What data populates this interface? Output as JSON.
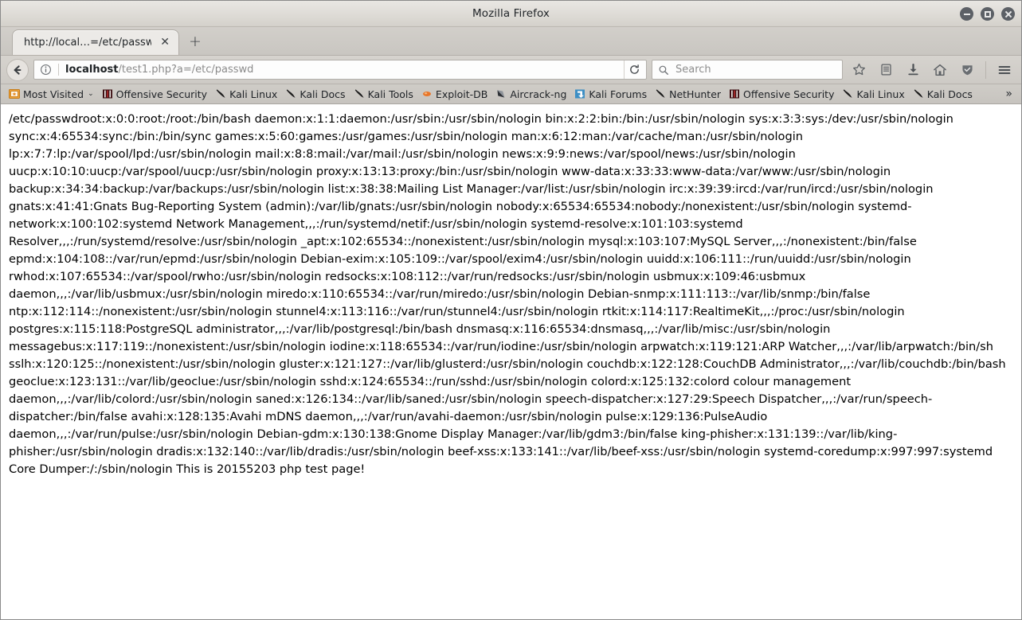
{
  "window": {
    "title": "Mozilla Firefox",
    "controls": [
      {
        "name": "minimize",
        "label": "–"
      },
      {
        "name": "maximize",
        "label": "□"
      },
      {
        "name": "close",
        "label": "✕"
      }
    ]
  },
  "tabs": {
    "items": [
      {
        "label": "http://local…=/etc/passwd",
        "close_label": "✕",
        "active": true
      }
    ],
    "new_tab_label": "+"
  },
  "toolbar": {
    "back_icon": "back-arrow-icon",
    "identity_icon": "info-circle-icon",
    "url_host": "localhost",
    "url_path": "/test1.php?a=/etc/passwd",
    "url_full": "localhost/test1.php?a=/etc/passwd",
    "reload_icon": "reload-icon",
    "search_placeholder": "Search",
    "search_value": "",
    "buttons": [
      {
        "name": "bookmark-star-button",
        "icon": "star-icon"
      },
      {
        "name": "library-button",
        "icon": "library-icon"
      },
      {
        "name": "downloads-button",
        "icon": "download-arrow-icon"
      },
      {
        "name": "home-button",
        "icon": "home-icon"
      },
      {
        "name": "tracking-protection-button",
        "icon": "shield-icon"
      },
      {
        "name": "menu-button",
        "icon": "hamburger-menu-icon"
      }
    ]
  },
  "bookmarks": {
    "items": [
      {
        "label": "Most Visited",
        "icon": "folder-star-icon",
        "caret": "⌄"
      },
      {
        "label": "Offensive Security",
        "icon": "offsec-icon"
      },
      {
        "label": "Kali Linux",
        "icon": "kali-dragon-icon"
      },
      {
        "label": "Kali Docs",
        "icon": "kali-dragon-icon"
      },
      {
        "label": "Kali Tools",
        "icon": "kali-dragon-icon"
      },
      {
        "label": "Exploit-DB",
        "icon": "exploitdb-icon"
      },
      {
        "label": "Aircrack-ng",
        "icon": "aircrack-icon"
      },
      {
        "label": "Kali Forums",
        "icon": "forums-icon"
      },
      {
        "label": "NetHunter",
        "icon": "kali-dragon-icon"
      },
      {
        "label": "Offensive Security",
        "icon": "offsec-icon"
      },
      {
        "label": "Kali Linux",
        "icon": "kali-dragon-icon"
      },
      {
        "label": "Kali Docs",
        "icon": "kali-dragon-icon"
      }
    ],
    "overflow_label": "»"
  },
  "page": {
    "body_text": "/etc/passwdroot:x:0:0:root:/root:/bin/bash daemon:x:1:1:daemon:/usr/sbin:/usr/sbin/nologin bin:x:2:2:bin:/bin:/usr/sbin/nologin sys:x:3:3:sys:/dev:/usr/sbin/nologin sync:x:4:65534:sync:/bin:/bin/sync games:x:5:60:games:/usr/games:/usr/sbin/nologin man:x:6:12:man:/var/cache/man:/usr/sbin/nologin lp:x:7:7:lp:/var/spool/lpd:/usr/sbin/nologin mail:x:8:8:mail:/var/mail:/usr/sbin/nologin news:x:9:9:news:/var/spool/news:/usr/sbin/nologin uucp:x:10:10:uucp:/var/spool/uucp:/usr/sbin/nologin proxy:x:13:13:proxy:/bin:/usr/sbin/nologin www-data:x:33:33:www-data:/var/www:/usr/sbin/nologin backup:x:34:34:backup:/var/backups:/usr/sbin/nologin list:x:38:38:Mailing List Manager:/var/list:/usr/sbin/nologin irc:x:39:39:ircd:/var/run/ircd:/usr/sbin/nologin gnats:x:41:41:Gnats Bug-Reporting System (admin):/var/lib/gnats:/usr/sbin/nologin nobody:x:65534:65534:nobody:/nonexistent:/usr/sbin/nologin systemd-network:x:100:102:systemd Network Management,,,:/run/systemd/netif:/usr/sbin/nologin systemd-resolve:x:101:103:systemd Resolver,,,:/run/systemd/resolve:/usr/sbin/nologin _apt:x:102:65534::/nonexistent:/usr/sbin/nologin mysql:x:103:107:MySQL Server,,,:/nonexistent:/bin/false epmd:x:104:108::/var/run/epmd:/usr/sbin/nologin Debian-exim:x:105:109::/var/spool/exim4:/usr/sbin/nologin uuidd:x:106:111::/run/uuidd:/usr/sbin/nologin rwhod:x:107:65534::/var/spool/rwho:/usr/sbin/nologin redsocks:x:108:112::/var/run/redsocks:/usr/sbin/nologin usbmux:x:109:46:usbmux daemon,,,:/var/lib/usbmux:/usr/sbin/nologin miredo:x:110:65534::/var/run/miredo:/usr/sbin/nologin Debian-snmp:x:111:113::/var/lib/snmp:/bin/false ntp:x:112:114::/nonexistent:/usr/sbin/nologin stunnel4:x:113:116::/var/run/stunnel4:/usr/sbin/nologin rtkit:x:114:117:RealtimeKit,,,:/proc:/usr/sbin/nologin postgres:x:115:118:PostgreSQL administrator,,,:/var/lib/postgresql:/bin/bash dnsmasq:x:116:65534:dnsmasq,,,:/var/lib/misc:/usr/sbin/nologin messagebus:x:117:119::/nonexistent:/usr/sbin/nologin iodine:x:118:65534::/var/run/iodine:/usr/sbin/nologin arpwatch:x:119:121:ARP Watcher,,,:/var/lib/arpwatch:/bin/sh sslh:x:120:125::/nonexistent:/usr/sbin/nologin gluster:x:121:127::/var/lib/glusterd:/usr/sbin/nologin couchdb:x:122:128:CouchDB Administrator,,,:/var/lib/couchdb:/bin/bash geoclue:x:123:131::/var/lib/geoclue:/usr/sbin/nologin sshd:x:124:65534::/run/sshd:/usr/sbin/nologin colord:x:125:132:colord colour management daemon,,,:/var/lib/colord:/usr/sbin/nologin saned:x:126:134::/var/lib/saned:/usr/sbin/nologin speech-dispatcher:x:127:29:Speech Dispatcher,,,:/var/run/speech-dispatcher:/bin/false avahi:x:128:135:Avahi mDNS daemon,,,:/var/run/avahi-daemon:/usr/sbin/nologin pulse:x:129:136:PulseAudio daemon,,,:/var/run/pulse:/usr/sbin/nologin Debian-gdm:x:130:138:Gnome Display Manager:/var/lib/gdm3:/bin/false king-phisher:x:131:139::/var/lib/king-phisher:/usr/sbin/nologin dradis:x:132:140::/var/lib/dradis:/usr/sbin/nologin beef-xss:x:133:141::/var/lib/beef-xss:/usr/sbin/nologin systemd-coredump:x:997:997:systemd Core Dumper:/:/sbin/nologin This is 20155203 php test page!"
  }
}
